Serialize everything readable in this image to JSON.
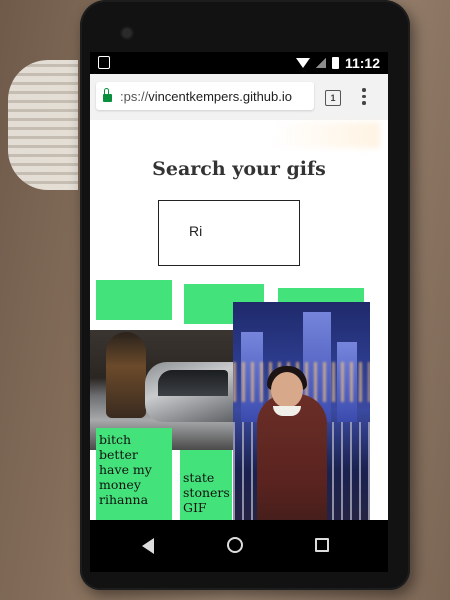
{
  "status_bar": {
    "time": "11:12",
    "icons": [
      "notification-icon",
      "wifi-icon",
      "signal-icon",
      "battery-icon"
    ]
  },
  "browser": {
    "url_prefix": ":ps://",
    "url_host": "vincentkempers.github.io",
    "tab_count": "1",
    "icons": [
      "lock-icon",
      "tabs-icon",
      "overflow-menu-icon"
    ],
    "secure_color": "#0a8f3c"
  },
  "page": {
    "title": "Search your gifs",
    "search_value": "Ri",
    "accent_color": "#44e27a",
    "gifs": [
      {
        "caption": "bitch better have my money rihanna"
      },
      {
        "caption": "state stoners GIF"
      }
    ]
  },
  "nav_bar": {
    "icons": [
      "back-icon",
      "home-icon",
      "recents-icon"
    ]
  }
}
